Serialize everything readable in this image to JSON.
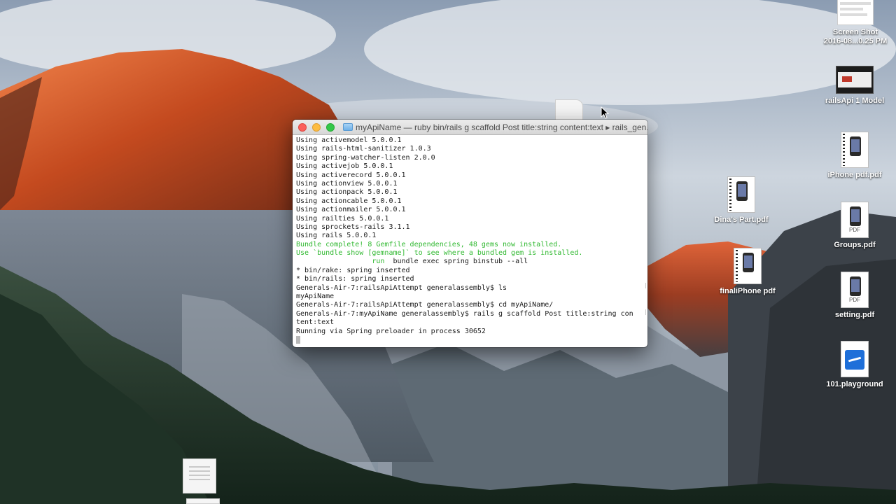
{
  "terminal": {
    "title": "myApiName — ruby bin/rails g scaffold Post title:string content:text ▸ rails_gen...",
    "lines": [
      {
        "text": "Using activemodel 5.0.0.1",
        "style": "normal"
      },
      {
        "text": "Using rails-html-sanitizer 1.0.3",
        "style": "normal"
      },
      {
        "text": "Using spring-watcher-listen 2.0.0",
        "style": "normal"
      },
      {
        "text": "Using activejob 5.0.0.1",
        "style": "normal"
      },
      {
        "text": "Using activerecord 5.0.0.1",
        "style": "normal"
      },
      {
        "text": "Using actionview 5.0.0.1",
        "style": "normal"
      },
      {
        "text": "Using actionpack 5.0.0.1",
        "style": "normal"
      },
      {
        "text": "Using actioncable 5.0.0.1",
        "style": "normal"
      },
      {
        "text": "Using actionmailer 5.0.0.1",
        "style": "normal"
      },
      {
        "text": "Using railties 5.0.0.1",
        "style": "normal"
      },
      {
        "text": "Using sprockets-rails 3.1.1",
        "style": "normal"
      },
      {
        "text": "Using rails 5.0.0.1",
        "style": "normal"
      },
      {
        "text": "Bundle complete! 8 Gemfile dependencies, 48 gems now installed.",
        "style": "green"
      },
      {
        "text": "Use `bundle show [gemname]` to see where a bundled gem is installed.",
        "style": "green"
      },
      {
        "text": "bundle exec spring binstub --all",
        "style": "run",
        "prefix": "         run  "
      },
      {
        "text": "* bin/rake: spring inserted",
        "style": "normal"
      },
      {
        "text": "* bin/rails: spring inserted",
        "style": "normal"
      },
      {
        "text": "Generals-Air-7:railsApiAttempt generalassembly$ ls",
        "style": "normal"
      },
      {
        "text": "myApiName",
        "style": "normal"
      },
      {
        "text": "Generals-Air-7:railsApiAttempt generalassembly$ cd myApiName/",
        "style": "normal"
      },
      {
        "text": "Generals-Air-7:myApiName generalassembly$ rails g scaffold Post title:string con",
        "style": "normal"
      },
      {
        "text": "tent:text",
        "style": "normal"
      },
      {
        "text": "Running via Spring preloader in process 30652",
        "style": "normal"
      }
    ]
  },
  "desktop": {
    "icons": {
      "screenshot": {
        "label_line1": "Screen Shot",
        "label_line2": "2016-08...0.25 PM",
        "icon": "screenshot-file-icon"
      },
      "rails_model": {
        "label": "railsApi 1 Model",
        "icon": "video-file-icon"
      },
      "iphone_pdf": {
        "label": "iPhone pdf.pdf",
        "icon": "pdf-file-icon"
      },
      "dinas_part": {
        "label": "Dina's Part.pdf",
        "icon": "pdf-file-icon"
      },
      "groups": {
        "label": "Groups.pdf",
        "icon": "pdf-file-icon",
        "tag": "PDF"
      },
      "finaliphone": {
        "label": "finaliPhone pdf",
        "icon": "pdf-file-icon"
      },
      "setting": {
        "label": "setting.pdf",
        "icon": "pdf-file-icon",
        "tag": "PDF"
      },
      "playground": {
        "label": "101.playground",
        "icon": "playground-file-icon"
      }
    }
  },
  "colors": {
    "terminal_green": "#2fb82f",
    "close": "#fc605c",
    "minimize": "#fdbc40",
    "maximize": "#34c84a"
  }
}
